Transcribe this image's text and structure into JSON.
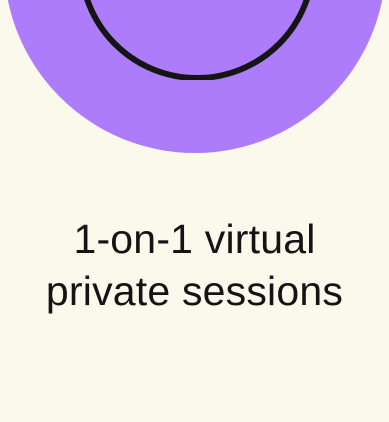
{
  "feature": {
    "title_line_1": "1-on-1 virtual",
    "title_line_2": "private sessions",
    "icon": "circle-ring-icon",
    "accent_color": "#ad7cfb",
    "background_color": "#fbf8ec"
  }
}
